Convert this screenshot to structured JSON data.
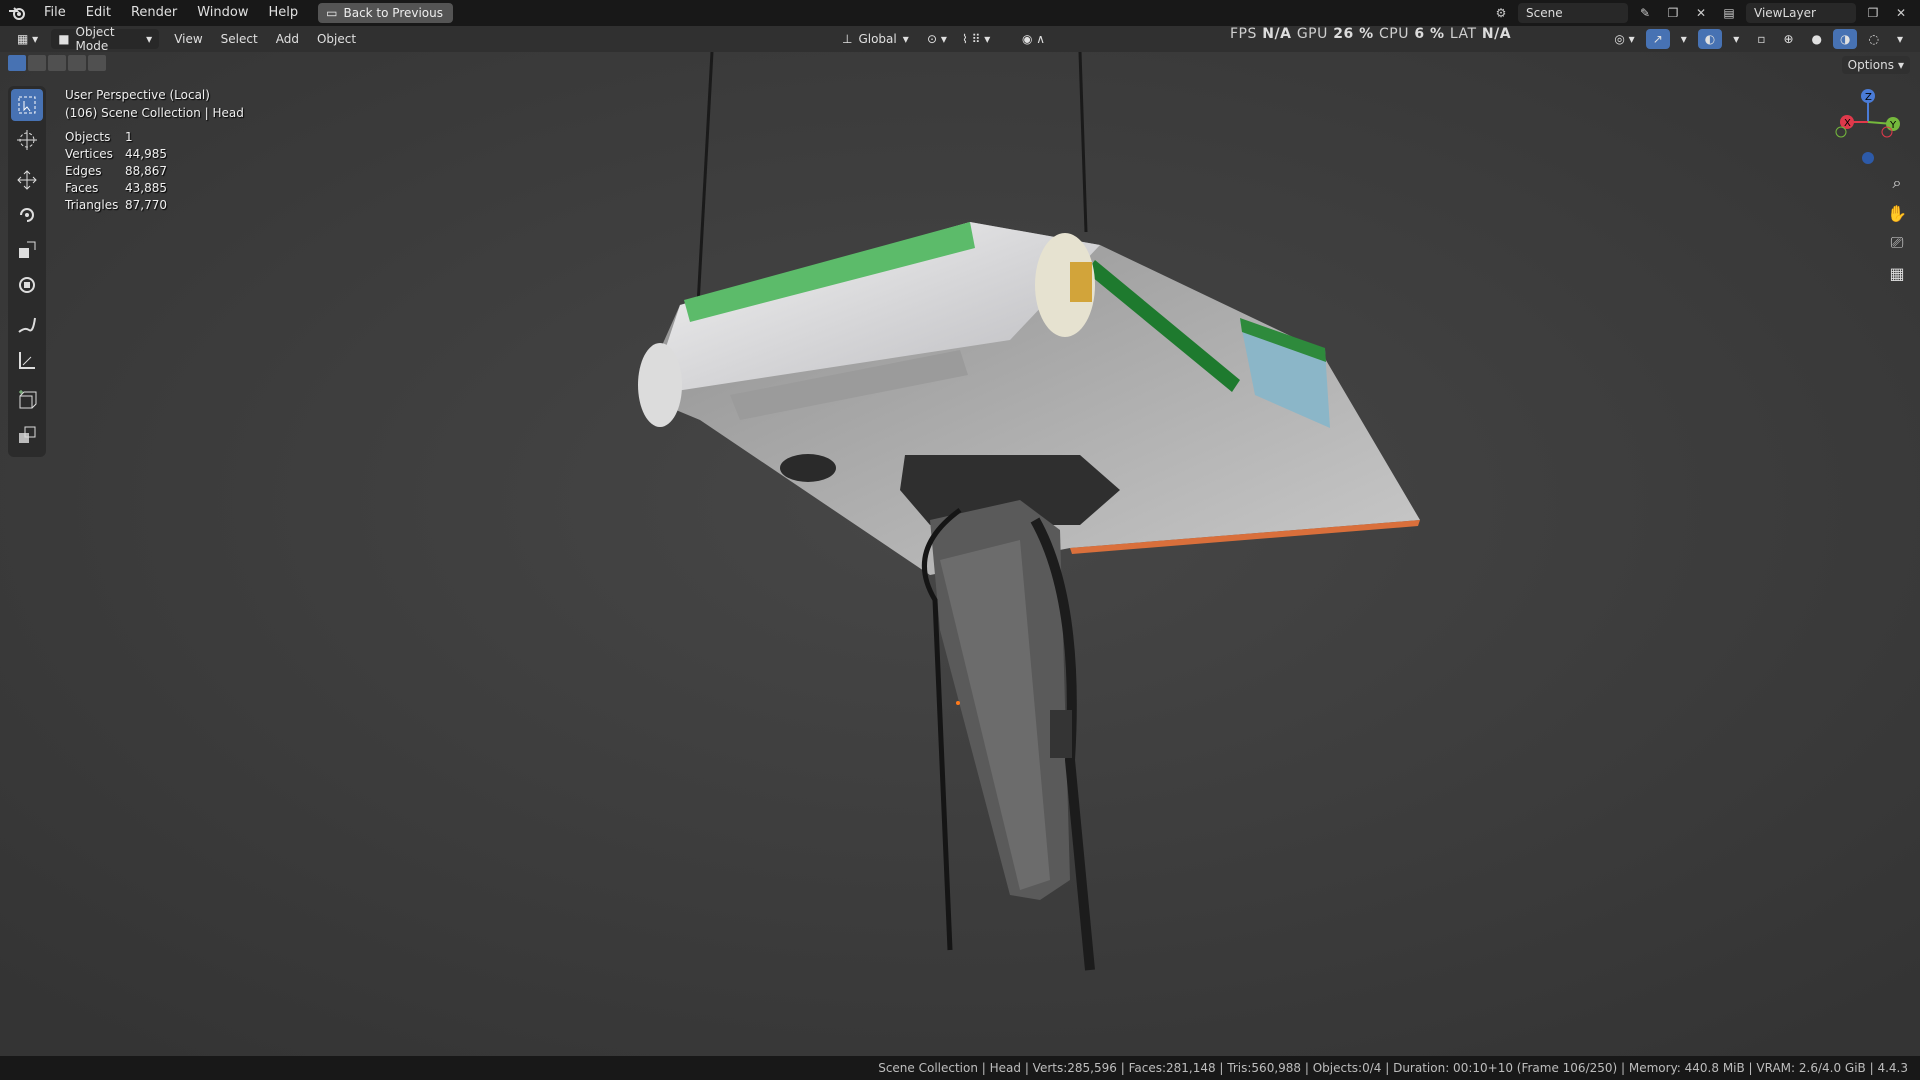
{
  "menu": {
    "items": [
      "File",
      "Edit",
      "Render",
      "Window",
      "Help"
    ],
    "back_label": "Back to Previous"
  },
  "scene": {
    "name": "Scene",
    "view_layer": "ViewLayer"
  },
  "header": {
    "mode": "Object Mode",
    "menus": [
      "View",
      "Select",
      "Add",
      "Object"
    ],
    "orientation": "Global"
  },
  "perf": {
    "fps_label": "FPS",
    "fps": "N/A",
    "gpu_label": "GPU",
    "gpu": "26 %",
    "cpu_label": "CPU",
    "cpu": "6 %",
    "lat_label": "LAT",
    "lat": "N/A"
  },
  "overlay": {
    "view": "User Perspective (Local)",
    "collection": "(106) Scene Collection | Head",
    "stats": [
      {
        "label": "Objects",
        "value": "1"
      },
      {
        "label": "Vertices",
        "value": "44,985"
      },
      {
        "label": "Edges",
        "value": "88,867"
      },
      {
        "label": "Faces",
        "value": "43,885"
      },
      {
        "label": "Triangles",
        "value": "87,770"
      }
    ]
  },
  "options_label": "Options",
  "gizmo": {
    "x": "X",
    "y": "Y",
    "z": "Z"
  },
  "statusbar": "Scene Collection | Head | Verts:285,596 | Faces:281,148 | Tris:560,988 | Objects:0/4 | Duration: 00:10+10 (Frame 106/250) | Memory: 440.8 MiB | VRAM: 2.6/4.0 GiB | 4.4.3",
  "colors": {
    "accent": "#4772b3",
    "body_green": "#3a9a4a",
    "background": "#3c3c3c"
  }
}
